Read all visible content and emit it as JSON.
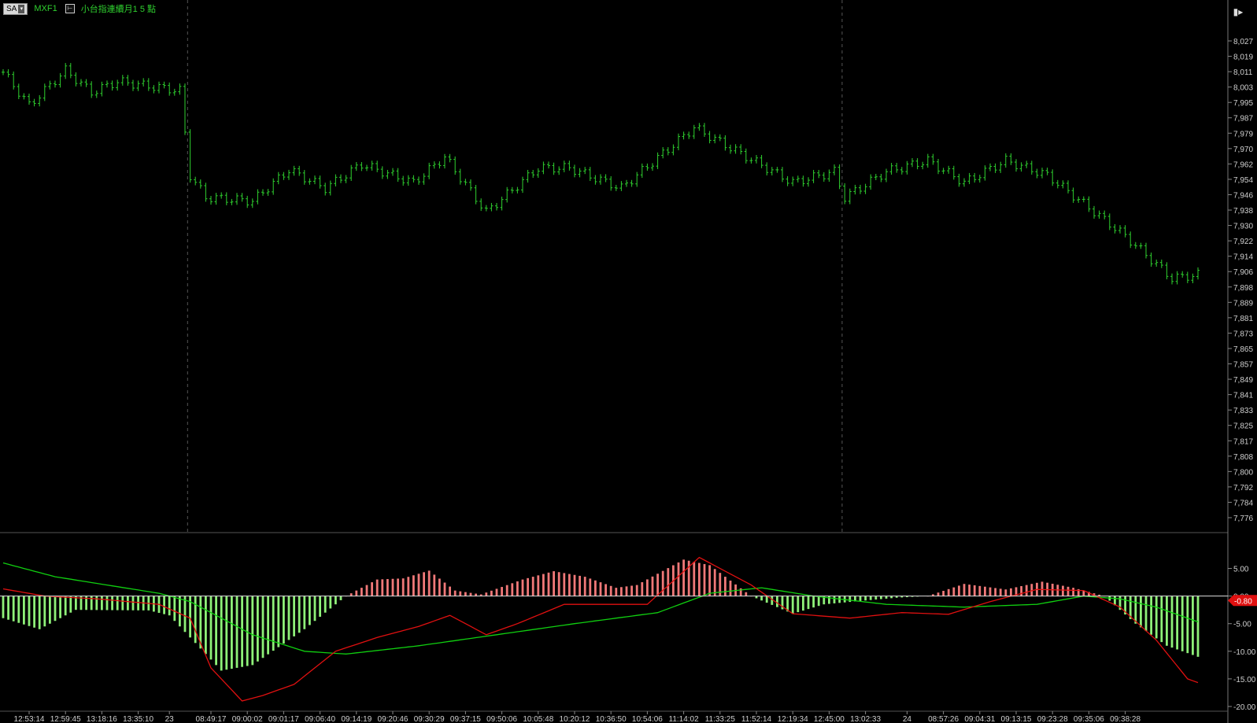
{
  "header": {
    "sa_label": "SA",
    "symbol": "MXF1",
    "title": "小台指連續月1 5 點",
    "corner_icon": "bar-split-icon"
  },
  "colors": {
    "price_bar": "#2fd02f",
    "hist_up": "#f07878",
    "hist_down": "#8ef078",
    "macd_line": "#e01010",
    "signal_line": "#10d010",
    "axis_text": "#cfcfcf",
    "last_value_bg": "#e01010"
  },
  "chart_data": [
    {
      "type": "line",
      "title": "",
      "subtype": "ohlc-bars",
      "price_axis_ticks": [
        8027,
        8019,
        8011,
        8003,
        7995,
        7987,
        7979,
        7970,
        7962,
        7954,
        7946,
        7938,
        7930,
        7922,
        7914,
        7906,
        7898,
        7889,
        7881,
        7873,
        7865,
        7857,
        7849,
        7841,
        7833,
        7825,
        7817,
        7808,
        7800,
        7792,
        7784,
        7776
      ],
      "ylim": [
        7776,
        8035
      ],
      "session_breaks": [
        35,
        161
      ],
      "key_closes": [
        {
          "i": 0,
          "v": 8018
        },
        {
          "i": 5,
          "v": 8000
        },
        {
          "i": 12,
          "v": 8019
        },
        {
          "i": 17,
          "v": 8007
        },
        {
          "i": 22,
          "v": 8013
        },
        {
          "i": 34,
          "v": 8008
        },
        {
          "i": 36,
          "v": 7962
        },
        {
          "i": 39,
          "v": 7950
        },
        {
          "i": 48,
          "v": 7948
        },
        {
          "i": 55,
          "v": 7965
        },
        {
          "i": 62,
          "v": 7955
        },
        {
          "i": 69,
          "v": 7968
        },
        {
          "i": 79,
          "v": 7958
        },
        {
          "i": 85,
          "v": 7972
        },
        {
          "i": 93,
          "v": 7942
        },
        {
          "i": 103,
          "v": 7966
        },
        {
          "i": 109,
          "v": 7966
        },
        {
          "i": 119,
          "v": 7955
        },
        {
          "i": 133,
          "v": 7988
        },
        {
          "i": 152,
          "v": 7958
        },
        {
          "i": 160,
          "v": 7964
        },
        {
          "i": 162,
          "v": 7950
        },
        {
          "i": 170,
          "v": 7964
        },
        {
          "i": 178,
          "v": 7970
        },
        {
          "i": 185,
          "v": 7958
        },
        {
          "i": 193,
          "v": 7970
        },
        {
          "i": 201,
          "v": 7962
        },
        {
          "i": 216,
          "v": 7929
        },
        {
          "i": 225,
          "v": 7906
        },
        {
          "i": 230,
          "v": 7908
        }
      ],
      "bar_count": 231
    },
    {
      "type": "bar",
      "title": "",
      "subtype": "macd-histogram",
      "ylim": [
        -20,
        8.5
      ],
      "axis_ticks": [
        "5.00",
        "0.00",
        "-5.00",
        "-10.00",
        "-15.00",
        "-20.00"
      ],
      "last_value": "-0.80",
      "hist_keys": [
        {
          "i": 0,
          "v": -4
        },
        {
          "i": 7,
          "v": -6
        },
        {
          "i": 14,
          "v": -2.5
        },
        {
          "i": 28,
          "v": -2.6
        },
        {
          "i": 32,
          "v": -3.5
        },
        {
          "i": 42,
          "v": -13.5
        },
        {
          "i": 48,
          "v": -12.5
        },
        {
          "i": 58,
          "v": -6
        },
        {
          "i": 66,
          "v": 0
        },
        {
          "i": 72,
          "v": 3
        },
        {
          "i": 77,
          "v": 3.2
        },
        {
          "i": 82,
          "v": 4.6
        },
        {
          "i": 87,
          "v": 1
        },
        {
          "i": 92,
          "v": 0.3
        },
        {
          "i": 100,
          "v": 3
        },
        {
          "i": 106,
          "v": 4.5
        },
        {
          "i": 112,
          "v": 3.5
        },
        {
          "i": 118,
          "v": 1.5
        },
        {
          "i": 122,
          "v": 2
        },
        {
          "i": 131,
          "v": 6.6
        },
        {
          "i": 136,
          "v": 5.6
        },
        {
          "i": 144,
          "v": 0
        },
        {
          "i": 152,
          "v": -3.2
        },
        {
          "i": 158,
          "v": -1.5
        },
        {
          "i": 166,
          "v": -0.8
        },
        {
          "i": 172,
          "v": -0.3
        },
        {
          "i": 178,
          "v": 0
        },
        {
          "i": 185,
          "v": 2.2
        },
        {
          "i": 193,
          "v": 1.2
        },
        {
          "i": 200,
          "v": 2.6
        },
        {
          "i": 206,
          "v": 1.5
        },
        {
          "i": 212,
          "v": 0
        },
        {
          "i": 218,
          "v": -5
        },
        {
          "i": 224,
          "v": -9
        },
        {
          "i": 230,
          "v": -11
        }
      ],
      "macd_keys": [
        {
          "i": 0,
          "v": 1.3
        },
        {
          "i": 8,
          "v": 0
        },
        {
          "i": 18,
          "v": -0.5
        },
        {
          "i": 30,
          "v": -1.5
        },
        {
          "i": 36,
          "v": -4
        },
        {
          "i": 40,
          "v": -13
        },
        {
          "i": 46,
          "v": -19
        },
        {
          "i": 50,
          "v": -18
        },
        {
          "i": 56,
          "v": -16
        },
        {
          "i": 64,
          "v": -10
        },
        {
          "i": 72,
          "v": -7.5
        },
        {
          "i": 80,
          "v": -5.5
        },
        {
          "i": 86,
          "v": -3.5
        },
        {
          "i": 93,
          "v": -7
        },
        {
          "i": 99,
          "v": -5
        },
        {
          "i": 108,
          "v": -1.5
        },
        {
          "i": 116,
          "v": -1.5
        },
        {
          "i": 124,
          "v": -1.5
        },
        {
          "i": 134,
          "v": 7
        },
        {
          "i": 144,
          "v": 2
        },
        {
          "i": 152,
          "v": -3.2
        },
        {
          "i": 163,
          "v": -4
        },
        {
          "i": 173,
          "v": -3
        },
        {
          "i": 182,
          "v": -3.3
        },
        {
          "i": 190,
          "v": -1
        },
        {
          "i": 199,
          "v": 1.2
        },
        {
          "i": 208,
          "v": 1
        },
        {
          "i": 215,
          "v": -2
        },
        {
          "i": 222,
          "v": -8
        },
        {
          "i": 228,
          "v": -15
        },
        {
          "i": 231,
          "v": -16
        }
      ],
      "signal_keys": [
        {
          "i": 0,
          "v": 6
        },
        {
          "i": 10,
          "v": 3.5
        },
        {
          "i": 20,
          "v": 2
        },
        {
          "i": 30,
          "v": 0.5
        },
        {
          "i": 36,
          "v": -1
        },
        {
          "i": 48,
          "v": -7
        },
        {
          "i": 58,
          "v": -10
        },
        {
          "i": 66,
          "v": -10.5
        },
        {
          "i": 80,
          "v": -9
        },
        {
          "i": 95,
          "v": -7
        },
        {
          "i": 110,
          "v": -5
        },
        {
          "i": 126,
          "v": -3
        },
        {
          "i": 136,
          "v": 0.5
        },
        {
          "i": 146,
          "v": 1.5
        },
        {
          "i": 156,
          "v": 0
        },
        {
          "i": 170,
          "v": -1.5
        },
        {
          "i": 185,
          "v": -2
        },
        {
          "i": 199,
          "v": -1.5
        },
        {
          "i": 208,
          "v": 0
        },
        {
          "i": 215,
          "v": -0.5
        },
        {
          "i": 222,
          "v": -2
        },
        {
          "i": 231,
          "v": -5
        }
      ]
    }
  ],
  "time_axis": {
    "labels": [
      {
        "i": 5,
        "t": "12:53:14"
      },
      {
        "i": 12,
        "t": "12:59:45"
      },
      {
        "i": 19,
        "t": "13:18:16"
      },
      {
        "i": 26,
        "t": "13:35:10"
      },
      {
        "i": 32,
        "t": "23"
      },
      {
        "i": 40,
        "t": "08:49:17"
      },
      {
        "i": 47,
        "t": "09:00:02"
      },
      {
        "i": 54,
        "t": "09:01:17"
      },
      {
        "i": 61,
        "t": "09:06:40"
      },
      {
        "i": 68,
        "t": "09:14:19"
      },
      {
        "i": 75,
        "t": "09:20:46"
      },
      {
        "i": 82,
        "t": "09:30:29"
      },
      {
        "i": 89,
        "t": "09:37:15"
      },
      {
        "i": 96,
        "t": "09:50:06"
      },
      {
        "i": 103,
        "t": "10:05:48"
      },
      {
        "i": 110,
        "t": "10:20:12"
      },
      {
        "i": 117,
        "t": "10:36:50"
      },
      {
        "i": 124,
        "t": "10:54:06"
      },
      {
        "i": 131,
        "t": "11:14:02"
      },
      {
        "i": 138,
        "t": "11:33:25"
      },
      {
        "i": 145,
        "t": "11:52:14"
      },
      {
        "i": 152,
        "t": "12:19:34"
      },
      {
        "i": 159,
        "t": "12:45:00"
      },
      {
        "i": 166,
        "t": "13:02:33"
      },
      {
        "i": 174,
        "t": "24"
      },
      {
        "i": 181,
        "t": "08:57:26"
      },
      {
        "i": 188,
        "t": "09:04:31"
      },
      {
        "i": 195,
        "t": "09:13:15"
      },
      {
        "i": 202,
        "t": "09:23:28"
      },
      {
        "i": 209,
        "t": "09:35:06"
      },
      {
        "i": 216,
        "t": "09:38:28"
      }
    ]
  }
}
